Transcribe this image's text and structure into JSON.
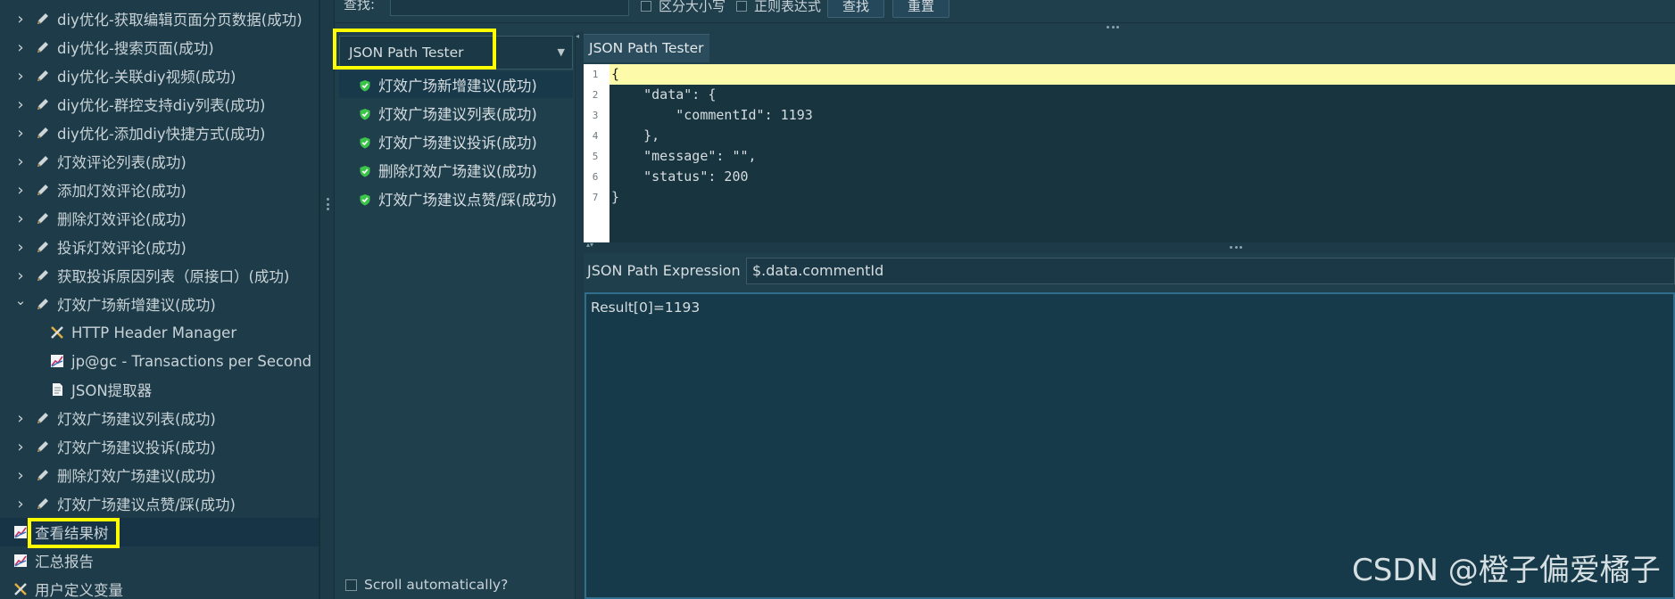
{
  "tree": {
    "items": [
      {
        "label": "diy优化-获取编辑页面分页数据(成功)",
        "icon": "pencil-icon",
        "indent": 1,
        "expanded": false
      },
      {
        "label": "diy优化-搜索页面(成功)",
        "icon": "pencil-icon",
        "indent": 1,
        "expanded": false
      },
      {
        "label": "diy优化-关联diy视频(成功)",
        "icon": "pencil-icon",
        "indent": 1,
        "expanded": false
      },
      {
        "label": "diy优化-群控支持diy列表(成功)",
        "icon": "pencil-icon",
        "indent": 1,
        "expanded": false
      },
      {
        "label": "diy优化-添加diy快捷方式(成功)",
        "icon": "pencil-icon",
        "indent": 1,
        "expanded": false
      },
      {
        "label": "灯效评论列表(成功)",
        "icon": "pencil-icon",
        "indent": 1,
        "expanded": false
      },
      {
        "label": "添加灯效评论(成功)",
        "icon": "pencil-icon",
        "indent": 1,
        "expanded": false
      },
      {
        "label": "删除灯效评论(成功)",
        "icon": "pencil-icon",
        "indent": 1,
        "expanded": false
      },
      {
        "label": "投诉灯效评论(成功)",
        "icon": "pencil-icon",
        "indent": 1,
        "expanded": false
      },
      {
        "label": "获取投诉原因列表（原接口）(成功)",
        "icon": "pencil-icon",
        "indent": 1,
        "expanded": false
      },
      {
        "label": "灯效广场新增建议(成功)",
        "icon": "pencil-icon",
        "indent": 1,
        "expanded": true
      },
      {
        "label": "HTTP Header Manager",
        "icon": "wrench-icon",
        "indent": 2
      },
      {
        "label": "jp@gc - Transactions per Second",
        "icon": "graph-icon",
        "indent": 2
      },
      {
        "label": "JSON提取器",
        "icon": "document-icon",
        "indent": 2
      },
      {
        "label": "灯效广场建议列表(成功)",
        "icon": "pencil-icon",
        "indent": 1,
        "expanded": false
      },
      {
        "label": "灯效广场建议投诉(成功)",
        "icon": "pencil-icon",
        "indent": 1,
        "expanded": false
      },
      {
        "label": "删除灯效广场建议(成功)",
        "icon": "pencil-icon",
        "indent": 1,
        "expanded": false
      },
      {
        "label": "灯效广场建议点赞/踩(成功)",
        "icon": "pencil-icon",
        "indent": 1,
        "expanded": false
      },
      {
        "label": "查看结果树",
        "icon": "graph-icon",
        "indent": 0,
        "selected": true
      },
      {
        "label": "汇总报告",
        "icon": "graph-icon",
        "indent": 0
      },
      {
        "label": "用户定义变量",
        "icon": "wrench-icon",
        "indent": 0
      }
    ]
  },
  "search": {
    "label": "查找:",
    "case_label": "区分大小写",
    "regex_label": "正则表达式",
    "find_button": "查找",
    "reset_button": "重置"
  },
  "renderer": {
    "selected": "JSON Path Tester"
  },
  "samples": [
    {
      "label": "灯效广场新增建议(成功)",
      "selected": true
    },
    {
      "label": "灯效广场建议列表(成功)"
    },
    {
      "label": "灯效广场建议投诉(成功)"
    },
    {
      "label": "删除灯效广场建议(成功)"
    },
    {
      "label": "灯效广场建议点赞/踩(成功)"
    }
  ],
  "scroll_auto_label": "Scroll automatically?",
  "tab_label": "JSON Path Tester",
  "editor": {
    "lines": [
      {
        "num": "1",
        "text": "{"
      },
      {
        "num": "2",
        "text": "    \"data\": {"
      },
      {
        "num": "3",
        "text": "        \"commentId\": 1193"
      },
      {
        "num": "4",
        "text": "    },"
      },
      {
        "num": "5",
        "text": "    \"message\": \"\","
      },
      {
        "num": "6",
        "text": "    \"status\": 200"
      },
      {
        "num": "7",
        "text": "}"
      }
    ]
  },
  "expression": {
    "label": "JSON Path Expression",
    "value": "$.data.commentId"
  },
  "result": "Result[0]=1193",
  "watermark": "CSDN @橙子偏爱橘子",
  "colors": {
    "highlight": "#ffff00",
    "success_green": "#3cc44a",
    "line_highlight": "#fdfba9"
  }
}
